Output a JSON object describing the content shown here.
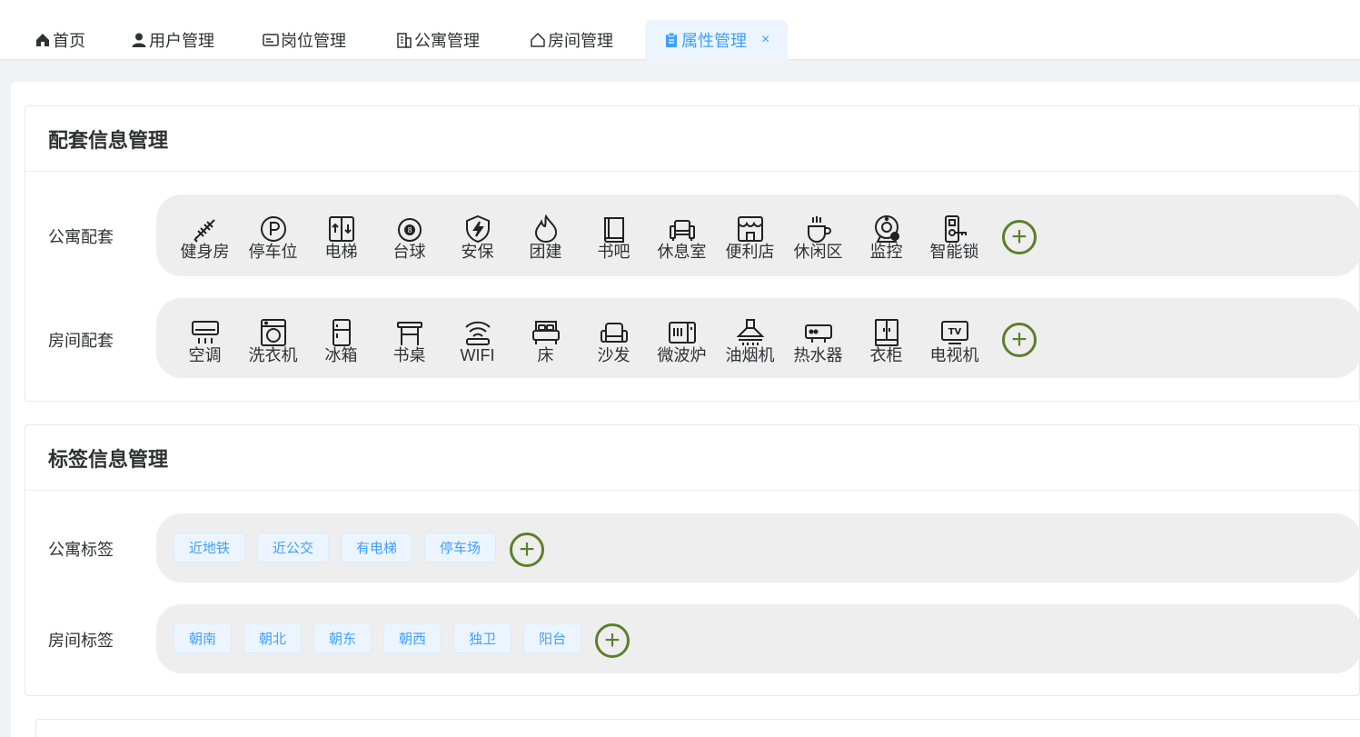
{
  "tabs": [
    {
      "label": "首页",
      "icon": "home-icon"
    },
    {
      "label": "用户管理",
      "icon": "user-icon"
    },
    {
      "label": "岗位管理",
      "icon": "id-card-icon"
    },
    {
      "label": "公寓管理",
      "icon": "building-icon"
    },
    {
      "label": "房间管理",
      "icon": "house-icon"
    },
    {
      "label": "属性管理",
      "icon": "clipboard-icon",
      "active": true,
      "close": "×"
    }
  ],
  "facility_section": {
    "title": "配套信息管理",
    "apartment_label": "公寓配套",
    "apartment_items": [
      "健身房",
      "停车位",
      "电梯",
      "台球",
      "安保",
      "团建",
      "书吧",
      "休息室",
      "便利店",
      "休闲区",
      "监控",
      "智能锁"
    ],
    "room_label": "房间配套",
    "room_items": [
      "空调",
      "洗衣机",
      "冰箱",
      "书桌",
      "WIFI",
      "床",
      "沙发",
      "微波炉",
      "油烟机",
      "热水器",
      "衣柜",
      "电视机"
    ],
    "add_symbol": "+"
  },
  "tag_section": {
    "title": "标签信息管理",
    "apartment_label": "公寓标签",
    "apartment_tags": [
      "近地铁",
      "近公交",
      "有电梯",
      "停车场"
    ],
    "room_label": "房间标签",
    "room_tags": [
      "朝南",
      "朝北",
      "朝东",
      "朝西",
      "独卫",
      "阳台"
    ]
  },
  "colors": {
    "accent": "#409eff",
    "add_green": "#5b7f2d",
    "pill_bg": "#eeeeee"
  }
}
